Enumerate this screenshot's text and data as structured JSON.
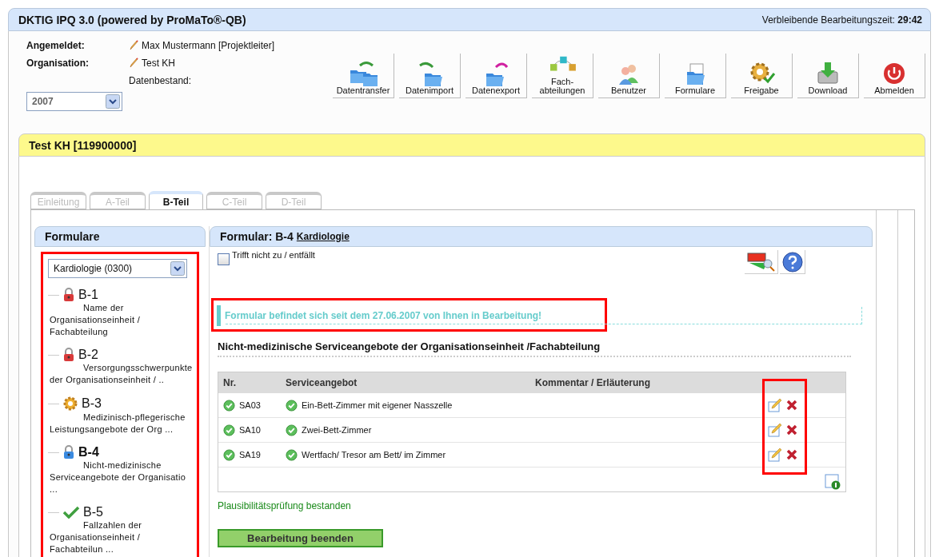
{
  "window": {
    "title": "DKTIG IPQ 3.0 (powered by ProMaTo®-QB)",
    "timer_label": "Verbleibende Bearbeitungszeit:",
    "timer_value": "29:42"
  },
  "user": {
    "fields": [
      {
        "label": "Angemeldet:",
        "value": "Max Mustermann [Projektleiter]"
      },
      {
        "label": "Organisation:",
        "value": "Test KH"
      }
    ],
    "dataset_label": "Datenbestand:",
    "dataset_value": "2007"
  },
  "toolbar": [
    {
      "label": "Datentransfer",
      "kind": "transfer"
    },
    {
      "label": "Datenimport",
      "kind": "import"
    },
    {
      "label": "Datenexport",
      "kind": "export"
    },
    {
      "label": "Fach-\nabteilungen",
      "kind": "departments"
    },
    {
      "label": "Benutzer",
      "kind": "users"
    },
    {
      "label": "Formulare",
      "kind": "forms"
    },
    {
      "label": "Freigabe",
      "kind": "release"
    },
    {
      "label": "Download",
      "kind": "download"
    },
    {
      "label": "Abmelden",
      "kind": "logout"
    }
  ],
  "org_bar": {
    "title": "Test KH [119900000]"
  },
  "tabs": [
    {
      "label": "Einleitung",
      "selected": false
    },
    {
      "label": "A-Teil",
      "selected": false
    },
    {
      "label": "B-Teil",
      "selected": true
    },
    {
      "label": "C-Teil",
      "selected": false
    },
    {
      "label": "D-Teil",
      "selected": false
    }
  ],
  "forms_panel": {
    "title": "Formulare",
    "department": "Kardiologie (0300)",
    "items": [
      {
        "code": "B-1",
        "description": "Name der Organisationseinheit / Fachabteilung",
        "kind": "locked",
        "selected": false
      },
      {
        "code": "B-2",
        "description": "Versorgungsschwerpunkte der Organisationseinheit / ..",
        "kind": "locked",
        "selected": false
      },
      {
        "code": "B-3",
        "description": "Medizinisch-pflegerische Leistungsangebote der Org ...",
        "kind": "in_progress",
        "selected": false
      },
      {
        "code": "B-4",
        "description": "Nicht-medizinische Serviceangebote der Organisatio ...",
        "kind": "current",
        "selected": true
      },
      {
        "code": "B-5",
        "description": "Fallzahlen der Organisationseinheit / Fachabteilun ...",
        "kind": "done",
        "selected": false
      }
    ]
  },
  "form": {
    "title": "Formular: B-4",
    "department_link": "Kardiologie",
    "not_applicable": {
      "label": "Trifft nicht zu / entfällt",
      "checked": false
    },
    "notice": "Formular befindet sich seit dem 27.06.2007 von Ihnen in Bearbeitung!",
    "section_title": "Nicht-medizinische Serviceangebote der Organisationseinheit /Fachabteilung",
    "table": {
      "columns": [
        "Nr.",
        "Serviceangebot",
        "Kommentar / Erläuterung"
      ],
      "rows": [
        {
          "nr": "SA03",
          "service": "Ein-Bett-Zimmer mit eigener Nasszelle"
        },
        {
          "nr": "SA10",
          "service": "Zwei-Bett-Zimmer"
        },
        {
          "nr": "SA19",
          "service": "Wertfach/ Tresor am Bett/ im Zimmer"
        }
      ]
    },
    "validation": "Plausibilitätsprüfung bestanden",
    "finish_button": "Bearbeitung beenden"
  }
}
